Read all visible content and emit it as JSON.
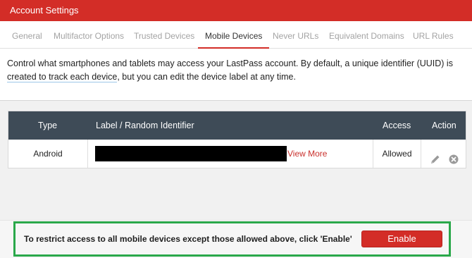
{
  "header": {
    "title": "Account Settings"
  },
  "tabs": [
    {
      "label": "General",
      "active": false
    },
    {
      "label": "Multifactor Options",
      "active": false
    },
    {
      "label": "Trusted Devices",
      "active": false
    },
    {
      "label": "Mobile Devices",
      "active": true
    },
    {
      "label": "Never URLs",
      "active": false
    },
    {
      "label": "Equivalent Domains",
      "active": false
    },
    {
      "label": "URL Rules",
      "active": false
    }
  ],
  "description": {
    "line1": "Control what smartphones and tablets may access your LastPass account. By default, a unique identifier (UUID) is",
    "line2_underlined": "created to track each device",
    "line2_rest": ", but you can edit the device label at any time."
  },
  "table": {
    "headers": {
      "type": "Type",
      "label": "Label / Random Identifier",
      "access": "Access",
      "action": "Action"
    },
    "rows": [
      {
        "type": "Android",
        "label_redacted": true,
        "view_more": "View More",
        "access": "Allowed",
        "actions": [
          "pencil-icon",
          "close-circle-icon"
        ]
      }
    ]
  },
  "footer": {
    "text": "To restrict access to all mobile devices except those allowed above, click 'Enable'",
    "button_label": "Enable"
  },
  "colors": {
    "brand_red": "#d32d27",
    "table_header": "#3e4b57",
    "highlight_green": "#2aa84a",
    "link_red": "#c9302c"
  }
}
